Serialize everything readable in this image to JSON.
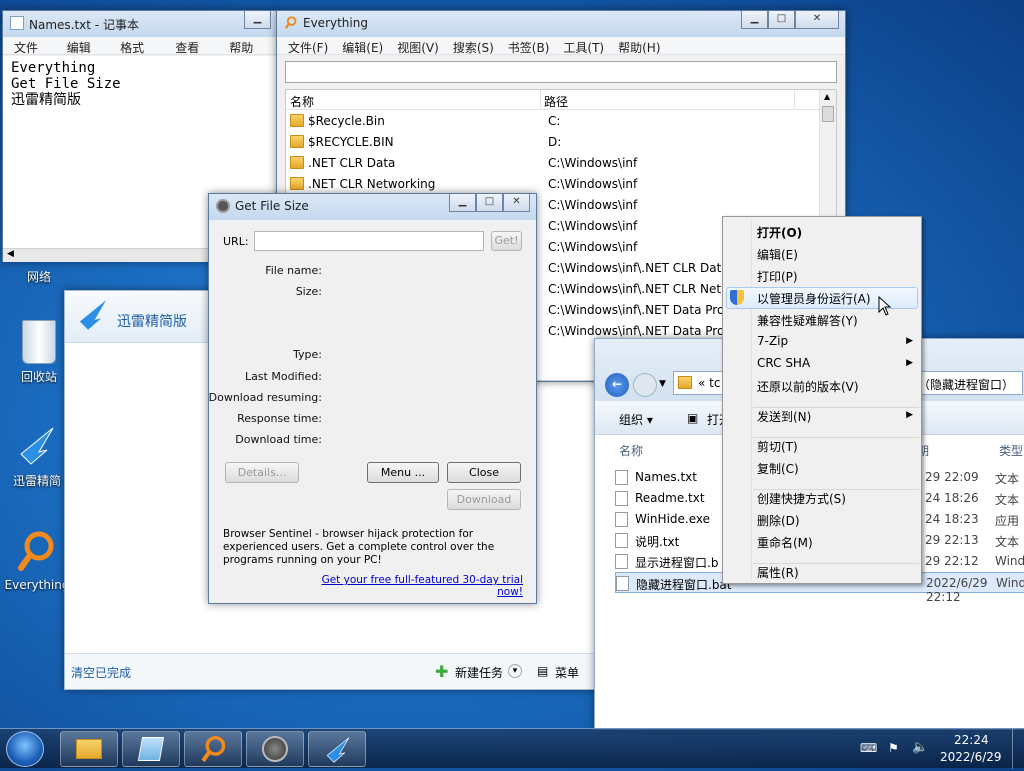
{
  "desktop": {
    "icons": [
      {
        "label": "网络"
      },
      {
        "label": "回收站"
      },
      {
        "label": "迅雷精简"
      },
      {
        "label": "Everything"
      }
    ]
  },
  "notepad": {
    "title": "Names.txt - 记事本",
    "menu": [
      "文件(F)",
      "编辑(E)",
      "格式(O)",
      "查看(V)",
      "帮助(H)"
    ],
    "lines": [
      "Everything",
      "Get File Size",
      "迅雷精简版"
    ]
  },
  "everything": {
    "title": "Everything",
    "menu": [
      "文件(F)",
      "编辑(E)",
      "视图(V)",
      "搜索(S)",
      "书签(B)",
      "工具(T)",
      "帮助(H)"
    ],
    "col_name": "名称",
    "col_path": "路径",
    "rows": [
      {
        "name": "$Recycle.Bin",
        "path": "C:"
      },
      {
        "name": "$RECYCLE.BIN",
        "path": "D:"
      },
      {
        "name": ".NET CLR Data",
        "path": "C:\\Windows\\inf"
      },
      {
        "name": ".NET CLR Networking",
        "path": "C:\\Windows\\inf"
      },
      {
        "name": "",
        "path": "C:\\Windows\\inf"
      },
      {
        "name": "",
        "path": "C:\\Windows\\inf"
      },
      {
        "name": "",
        "path": "C:\\Windows\\inf"
      },
      {
        "name": "",
        "path": "C:\\Windows\\inf\\.NET CLR Data"
      },
      {
        "name": "",
        "path": "C:\\Windows\\inf\\.NET CLR Netw"
      },
      {
        "name": "",
        "path": "C:\\Windows\\inf\\.NET Data Prov"
      },
      {
        "name": "",
        "path": "C:\\Windows\\inf\\.NET Data Prov"
      }
    ]
  },
  "xunlei": {
    "title": "迅雷精简版",
    "status": "清空已完成",
    "new_task": "新建任务",
    "menu": "菜单"
  },
  "getfilesize": {
    "title": "Get File Size",
    "url_label": "URL:",
    "get_btn": "Get!",
    "labels": [
      "File name:",
      "Size:",
      "Type:",
      "Last Modified:",
      "Download resuming:",
      "Response time:",
      "Download time:"
    ],
    "details_btn": "Details...",
    "menu_btn": "Menu ...",
    "close_btn": "Close",
    "download_btn": "Download",
    "promo": "Browser Sentinel - browser hijack protection for experienced users. Get a complete control over the programs running on your PC!",
    "trial_link": "Get your free full-featured 30-day trial now!"
  },
  "explorer": {
    "path_prefix": "«  tc",
    "path_suffix": "（隐藏进程窗口）",
    "organize": "组织 ▾",
    "open": "打开",
    "col_name": "名称",
    "col_date": "期",
    "col_type": "类型",
    "files": [
      {
        "name": "Names.txt",
        "date": "29 22:09",
        "type": "文本"
      },
      {
        "name": "Readme.txt",
        "date": "24 18:26",
        "type": "文本"
      },
      {
        "name": "WinHide.exe",
        "date": "24 18:23",
        "type": "应用"
      },
      {
        "name": "说明.txt",
        "date": "29 22:13",
        "type": "文本"
      },
      {
        "name": "显示进程窗口.b",
        "date": "29 22:12",
        "type": "Wind"
      },
      {
        "name": "隐藏进程窗口.bat",
        "date": "2022/6/29 22:12",
        "type": "Wind"
      }
    ]
  },
  "context_menu": {
    "items": [
      {
        "label": "打开(O)",
        "bold": true
      },
      {
        "label": "编辑(E)"
      },
      {
        "label": "打印(P)"
      },
      {
        "label": "以管理员身份运行(A)",
        "highlight": true
      },
      {
        "label": "兼容性疑难解答(Y)"
      },
      {
        "label": "7-Zip",
        "sub": true
      },
      {
        "label": "CRC SHA",
        "sub": true
      },
      {
        "label": "还原以前的版本(V)"
      },
      {
        "label": "发送到(N)",
        "sub": true
      },
      {
        "label": "剪切(T)"
      },
      {
        "label": "复制(C)"
      },
      {
        "label": "创建快捷方式(S)"
      },
      {
        "label": "删除(D)"
      },
      {
        "label": "重命名(M)"
      },
      {
        "label": "属性(R)"
      }
    ]
  },
  "taskbar": {
    "time": "22:24",
    "date": "2022/6/29"
  }
}
